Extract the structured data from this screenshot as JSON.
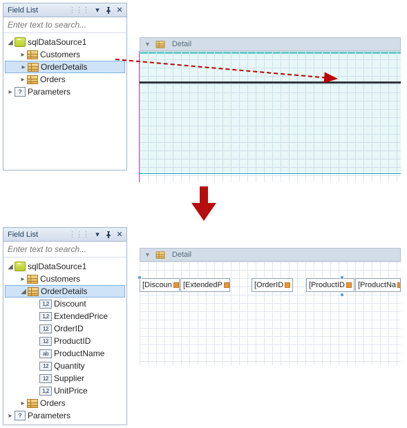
{
  "top": {
    "panel": {
      "title": "Field List",
      "search_placeholder": "Enter text to search...",
      "nodes": {
        "ds": "sqlDataSource1",
        "customers": "Customers",
        "orderDetails": "OrderDetails",
        "orders": "Orders",
        "parameters": "Parameters"
      }
    },
    "band": "Detail"
  },
  "bottom": {
    "panel": {
      "title": "Field List",
      "search_placeholder": "Enter text to search...",
      "nodes": {
        "ds": "sqlDataSource1",
        "customers": "Customers",
        "orderDetails": "OrderDetails",
        "orders": "Orders",
        "parameters": "Parameters"
      },
      "fields": {
        "discount": {
          "label": "Discount",
          "type": "1,2"
        },
        "extendedPrice": {
          "label": "ExtendedPrice",
          "type": "1,2"
        },
        "orderID": {
          "label": "OrderID",
          "type": "12"
        },
        "productID": {
          "label": "ProductID",
          "type": "12"
        },
        "productName": {
          "label": "ProductName",
          "type": "ab"
        },
        "quantity": {
          "label": "Quantity",
          "type": "12"
        },
        "supplier": {
          "label": "Supplier",
          "type": "12"
        },
        "unitPrice": {
          "label": "UnitPrice",
          "type": "1,2"
        }
      }
    },
    "band": "Detail",
    "cells": {
      "c0": "[Discoun",
      "c1": "[ExtendedP",
      "c2": "[OrderID",
      "c3": "[ProductID",
      "c4": "[ProductNa"
    }
  }
}
